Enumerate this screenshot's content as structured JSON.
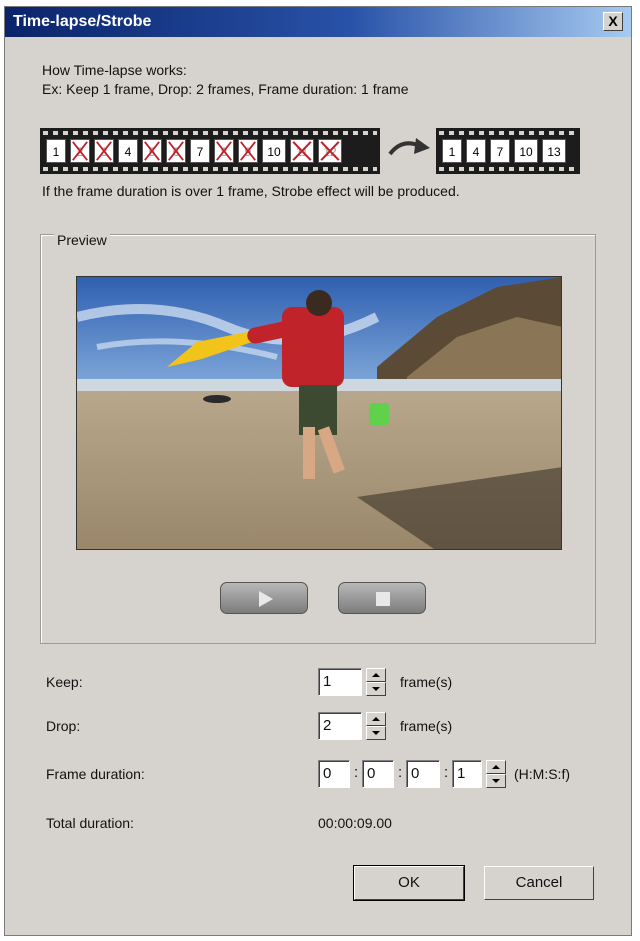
{
  "window": {
    "title": "Time-lapse/Strobe",
    "close_label": "X"
  },
  "intro": {
    "line1": "How Time-lapse works:",
    "line2": "Ex: Keep 1 frame, Drop: 2 frames, Frame duration: 1 frame"
  },
  "diagram": {
    "source_frames": [
      {
        "label": "1",
        "dropped": false
      },
      {
        "label": "2",
        "dropped": true
      },
      {
        "label": "3",
        "dropped": true
      },
      {
        "label": "4",
        "dropped": false
      },
      {
        "label": "5",
        "dropped": true
      },
      {
        "label": "6",
        "dropped": true
      },
      {
        "label": "7",
        "dropped": false
      },
      {
        "label": "8",
        "dropped": true
      },
      {
        "label": "9",
        "dropped": true
      },
      {
        "label": "10",
        "dropped": false
      },
      {
        "label": "11",
        "dropped": true
      },
      {
        "label": "12",
        "dropped": true
      }
    ],
    "result_frames": [
      "1",
      "4",
      "7",
      "10",
      "13"
    ],
    "note": "If the frame duration is over 1 frame, Strobe effect will be produced."
  },
  "preview": {
    "label": "Preview",
    "play_icon": "play-icon",
    "stop_icon": "stop-icon"
  },
  "keep": {
    "label": "Keep:",
    "value": "1",
    "unit": "frame(s)"
  },
  "drop": {
    "label": "Drop:",
    "value": "2",
    "unit": "frame(s)"
  },
  "frame_duration": {
    "label": "Frame duration:",
    "h": "0",
    "m": "0",
    "s": "0",
    "f": "1",
    "unit": "(H:M:S:f)"
  },
  "total_duration": {
    "label": "Total duration:",
    "value": "00:00:09.00"
  },
  "buttons": {
    "ok": "OK",
    "cancel": "Cancel"
  },
  "colors": {
    "title_bar": "#0a246a",
    "dialog_bg": "#d6d3ce"
  }
}
